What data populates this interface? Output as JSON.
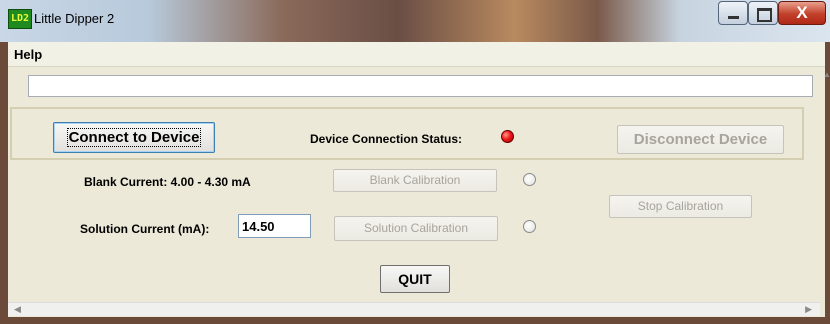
{
  "window": {
    "app_icon_text": "LD2",
    "title": "Little Dipper 2",
    "close_glyph": "X"
  },
  "menu": {
    "help": "Help"
  },
  "status_field": {
    "value": ""
  },
  "connection": {
    "connect_label": "Connect to Device",
    "status_label": "Device Connection Status:",
    "status_color": "#e01010",
    "disconnect_label": "Disconnect Device"
  },
  "calibration": {
    "blank_label": "Blank Current: 4.00 - 4.30 mA",
    "blank_button": "Blank Calibration",
    "solution_label": "Solution Current (mA):",
    "solution_value": "14.50",
    "solution_button": "Solution Calibration",
    "stop_button": "Stop Calibration"
  },
  "actions": {
    "quit_label": "QUIT"
  },
  "icons": {
    "minimize": "minimize-icon",
    "maximize": "maximize-icon",
    "close": "close-icon",
    "scroll_left": "scroll-left-arrow-icon",
    "scroll_right": "scroll-right-arrow-icon",
    "scroll_up": "scroll-up-arrow-icon"
  }
}
